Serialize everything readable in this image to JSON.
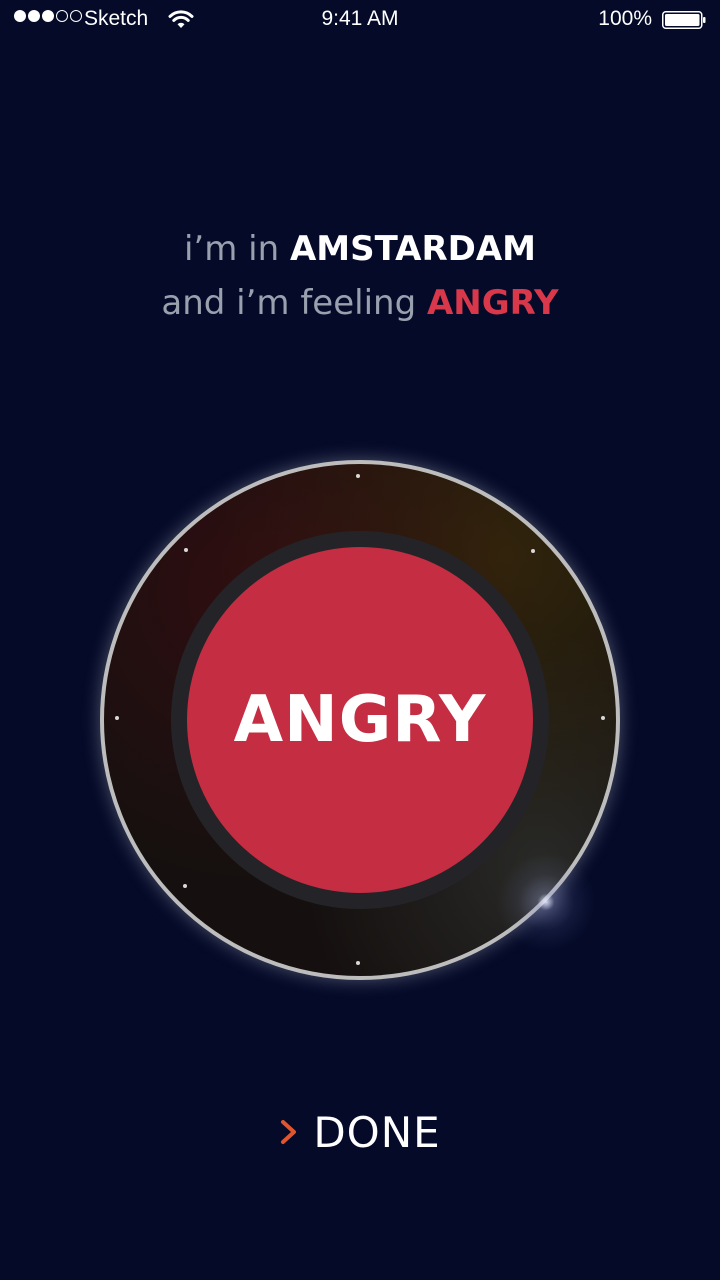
{
  "status_bar": {
    "carrier": "Sketch",
    "time": "9:41 AM",
    "battery_percent": "100%",
    "signal_bars_filled": 3,
    "signal_bars_total": 5
  },
  "headline": {
    "line1_prefix": "i’m in",
    "city": "AMSTARDAM",
    "line2_prefix": "and i’m feeling",
    "mood": "ANGRY"
  },
  "dial": {
    "mood_label": "ANGRY"
  },
  "done_button": {
    "label": "DONE",
    "icon": "chevron-right-icon"
  },
  "colors": {
    "background": "#040a28",
    "accent_red": "#c52d42",
    "mood_text_red": "#d8384a",
    "chevron_orange": "#e0552d",
    "dim_text": "#9aa0ae"
  }
}
